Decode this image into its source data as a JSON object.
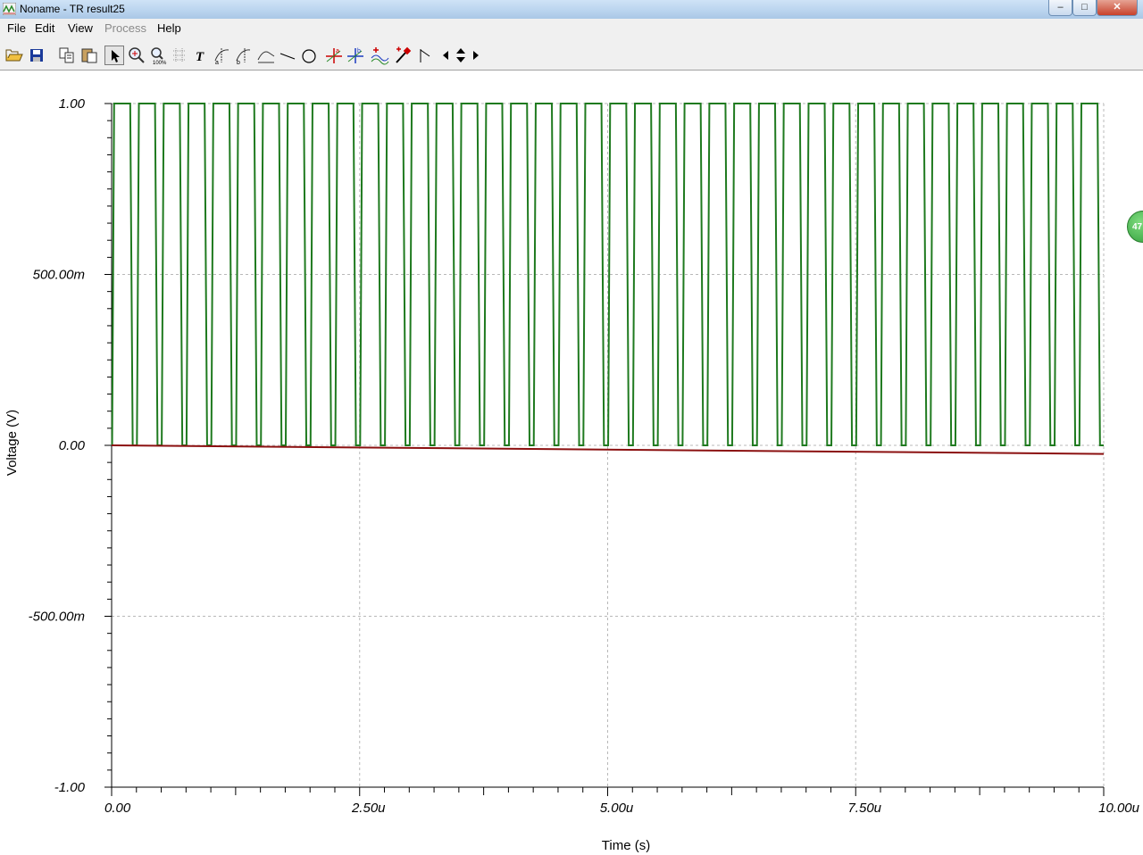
{
  "window": {
    "title": "Noname - TR result25",
    "min_glyph": "–",
    "max_glyph": "□",
    "close_glyph": "✕"
  },
  "menu": {
    "items": [
      {
        "label": "File",
        "enabled": true
      },
      {
        "label": "Edit",
        "enabled": true
      },
      {
        "label": "View",
        "enabled": true
      },
      {
        "label": "Process",
        "enabled": false
      },
      {
        "label": "Help",
        "enabled": true
      }
    ]
  },
  "toolbar": {
    "icons": [
      "open-folder-icon",
      "save-icon",
      "copy-icon",
      "paste-icon",
      "select-arrow-icon",
      "zoom-in-icon",
      "zoom-100-icon",
      "grid-icon",
      "text-icon",
      "cursor-a-icon",
      "cursor-b-icon",
      "cursor-diff-icon",
      "line-icon",
      "ellipse-icon",
      "marker-a-icon",
      "marker-b-icon",
      "add-curve-icon",
      "probe-icon",
      "flag-icon",
      "pan-left-icon",
      "pan-updown-icon",
      "pan-right-icon"
    ]
  },
  "side_badge": {
    "text": "47"
  },
  "colors": {
    "series_pulse": "#1f7a1f",
    "series_drift": "#8b1010",
    "grid": "#b8b8b8"
  },
  "chart_data": {
    "type": "line",
    "xlabel": "Time (s)",
    "ylabel": "Voltage (V)",
    "xlim": [
      0,
      10.0
    ],
    "x_unit_note": "u",
    "ylim": [
      -1.0,
      1.0
    ],
    "x_ticks": [
      "0.00",
      "2.50u",
      "5.00u",
      "7.50u",
      "10.00u"
    ],
    "y_ticks": [
      "1.00",
      "500.00m",
      "0.00",
      "-500.00m",
      "-1.00"
    ],
    "grid": true,
    "series": [
      {
        "kind": "square_wave",
        "period_us": 0.25,
        "duty": 0.8,
        "low": 0.0,
        "high": 1.0,
        "x_start": 0.0,
        "x_end": 10.0
      },
      {
        "kind": "line",
        "x": [
          0.0,
          10.0
        ],
        "y": [
          0.0,
          -0.025
        ]
      }
    ]
  }
}
